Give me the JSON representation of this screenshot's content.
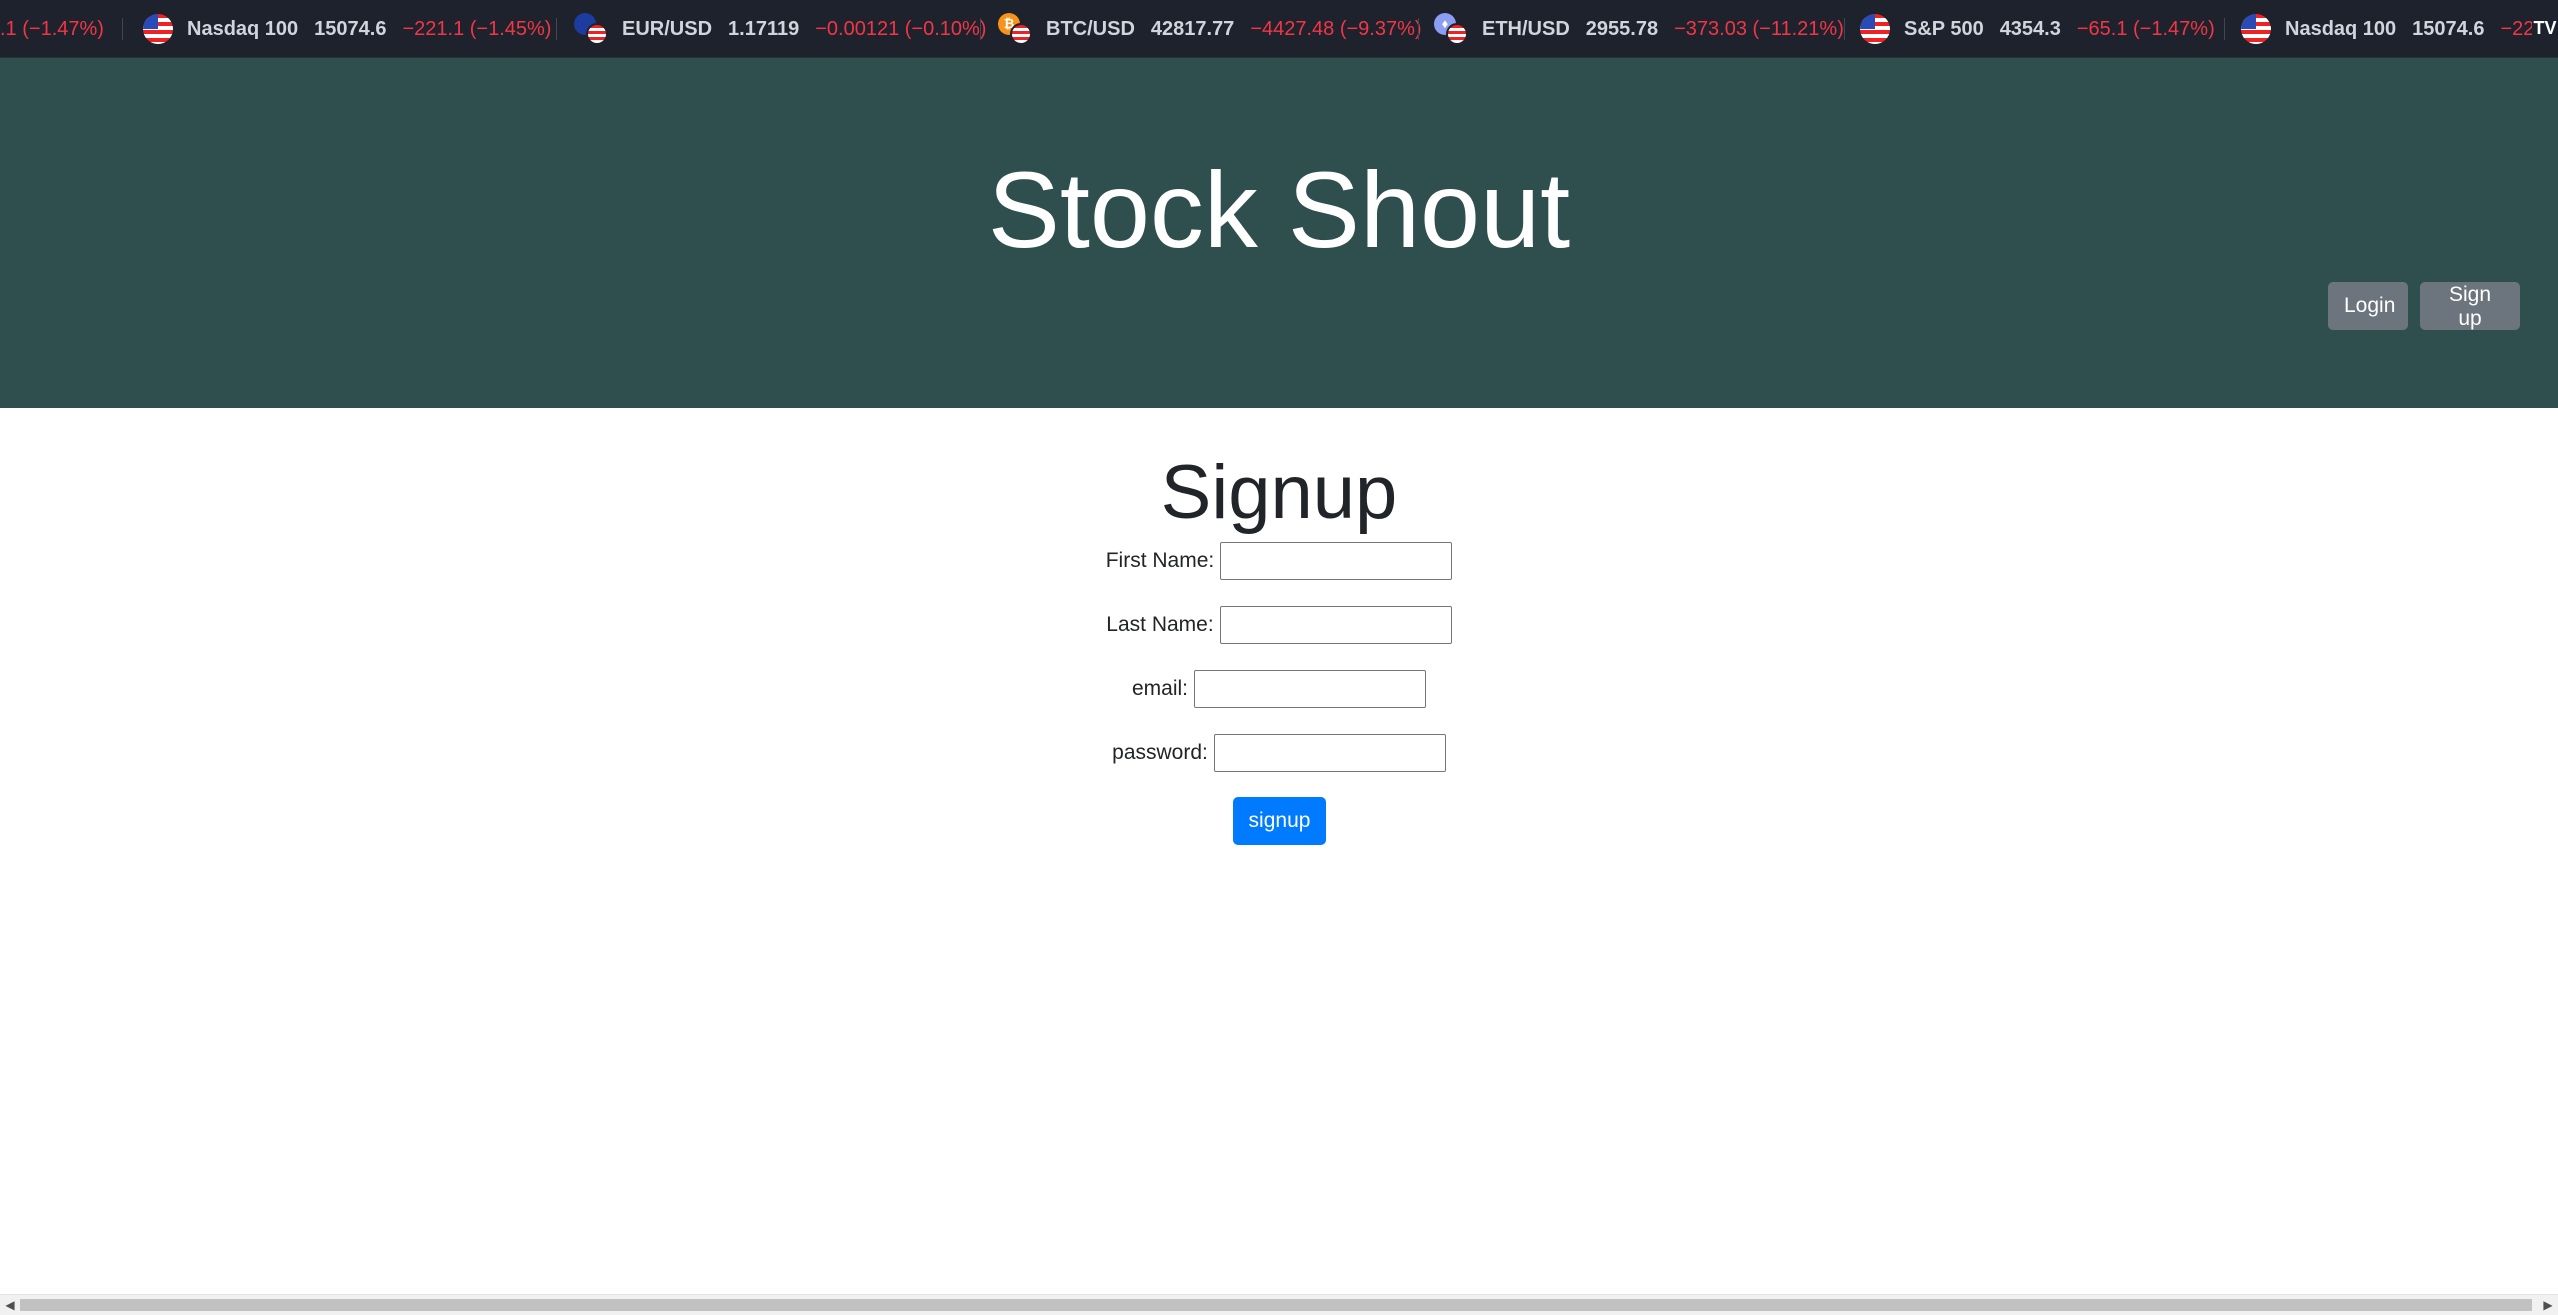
{
  "ticker": {
    "items": [
      {
        "symbol": "",
        "price": "",
        "change": ".1 (−1.47%)",
        "icon": "us-flag-icon"
      },
      {
        "symbol": "Nasdaq 100",
        "price": "15074.6",
        "change": "−221.1 (−1.45%)",
        "icon": "us-flag-icon"
      },
      {
        "symbol": "EUR/USD",
        "price": "1.17119",
        "change": "−0.00121 (−0.10%)",
        "icon": "eur-usd-flag-icon"
      },
      {
        "symbol": "BTC/USD",
        "price": "42817.77",
        "change": "−4427.48 (−9.37%)",
        "icon": "btc-usd-icon"
      },
      {
        "symbol": "ETH/USD",
        "price": "2955.78",
        "change": "−373.03 (−11.21%)",
        "icon": "eth-usd-icon"
      },
      {
        "symbol": "S&P 500",
        "price": "4354.3",
        "change": "−65.1 (−1.47%)",
        "icon": "us-flag-icon"
      },
      {
        "symbol": "Nasdaq 100",
        "price": "15074.6",
        "change": "−22",
        "icon": "us-flag-icon"
      }
    ],
    "logo": "TV",
    "down_color": "#f23645"
  },
  "header": {
    "title": "Stock Shout",
    "login_label": "Login",
    "signup_label": "Sign up",
    "bg_color": "#2f4f4f"
  },
  "form": {
    "title": "Signup",
    "first_name_label": "First Name:",
    "last_name_label": "Last Name:",
    "email_label": "email:",
    "password_label": "password:",
    "first_name_value": "",
    "last_name_value": "",
    "email_value": "",
    "password_value": "",
    "submit_label": "signup",
    "submit_color": "#007bff"
  },
  "scrollbar": {
    "left_arrow": "◀",
    "right_arrow": "▶"
  }
}
